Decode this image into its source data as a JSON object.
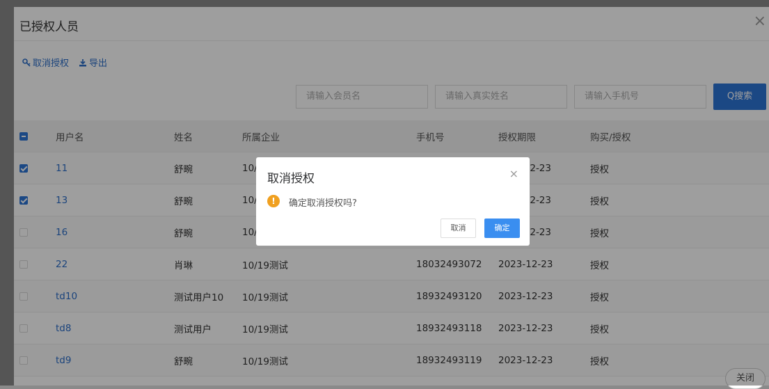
{
  "panel": {
    "title": "已授权人员",
    "close_icon": "×"
  },
  "toolbar": {
    "revoke_label": "取消授权",
    "export_label": "导出"
  },
  "search": {
    "member_placeholder": "请输入会员名",
    "realname_placeholder": "请输入真实姓名",
    "phone_placeholder": "请输入手机号",
    "button_label": "Q搜索"
  },
  "table": {
    "headers": [
      "用户名",
      "姓名",
      "所属企业",
      "手机号",
      "授权期限",
      "购买/授权"
    ],
    "rows": [
      {
        "checked": true,
        "username": "11",
        "name": "舒畹",
        "company": "10/",
        "phone": "",
        "expiry": "-12-23",
        "type": "授权"
      },
      {
        "checked": true,
        "username": "13",
        "name": "舒畹",
        "company": "10/",
        "phone": "",
        "expiry": "-12-23",
        "type": "授权"
      },
      {
        "checked": false,
        "username": "16",
        "name": "舒畹",
        "company": "10/",
        "phone": "",
        "expiry": "-12-23",
        "type": "授权"
      },
      {
        "checked": false,
        "username": "22",
        "name": "肖琳",
        "company": "10/19测试",
        "phone": "18032493072",
        "expiry": "2023-12-23",
        "type": "授权"
      },
      {
        "checked": false,
        "username": "td10",
        "name": "测试用户10",
        "company": "10/19测试",
        "phone": "18932493120",
        "expiry": "2023-12-23",
        "type": "授权"
      },
      {
        "checked": false,
        "username": "td8",
        "name": "测试用户",
        "company": "10/19测试",
        "phone": "18932493118",
        "expiry": "2023-12-23",
        "type": "授权"
      },
      {
        "checked": false,
        "username": "td9",
        "name": "舒畹",
        "company": "10/19测试",
        "phone": "18932493119",
        "expiry": "2023-12-23",
        "type": "授权"
      }
    ]
  },
  "footer": {
    "close_label": "关闭"
  },
  "dialog": {
    "title": "取消授权",
    "close_icon": "×",
    "warning_icon": "!",
    "message": "确定取消授权吗?",
    "cancel_label": "取消",
    "confirm_label": "确定"
  },
  "colors": {
    "primary": "#2d74d6",
    "link": "#2d6ec9",
    "warning": "#f0a020",
    "confirm": "#3a8ef0"
  }
}
